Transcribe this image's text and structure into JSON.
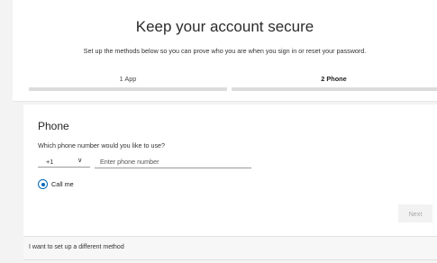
{
  "header": {
    "title": "Keep your account secure",
    "subtitle": "Set up the methods below so you can prove who you are when you sign in or reset your password."
  },
  "steps": [
    {
      "label": "1   App",
      "state": "complete"
    },
    {
      "label": "2   Phone",
      "state": "current"
    }
  ],
  "phone_form": {
    "heading": "Phone",
    "question": "Which phone number would you like to use?",
    "country_code": "+1",
    "chevron": "∨",
    "phone_placeholder": "Enter phone number",
    "option_label": "Call me",
    "option_selected": true,
    "next_label": "Next"
  },
  "footer": {
    "different_method": "I want to set up a different method"
  },
  "colors": {
    "accent": "#0067b8",
    "page_background": "#f3f3f3"
  }
}
